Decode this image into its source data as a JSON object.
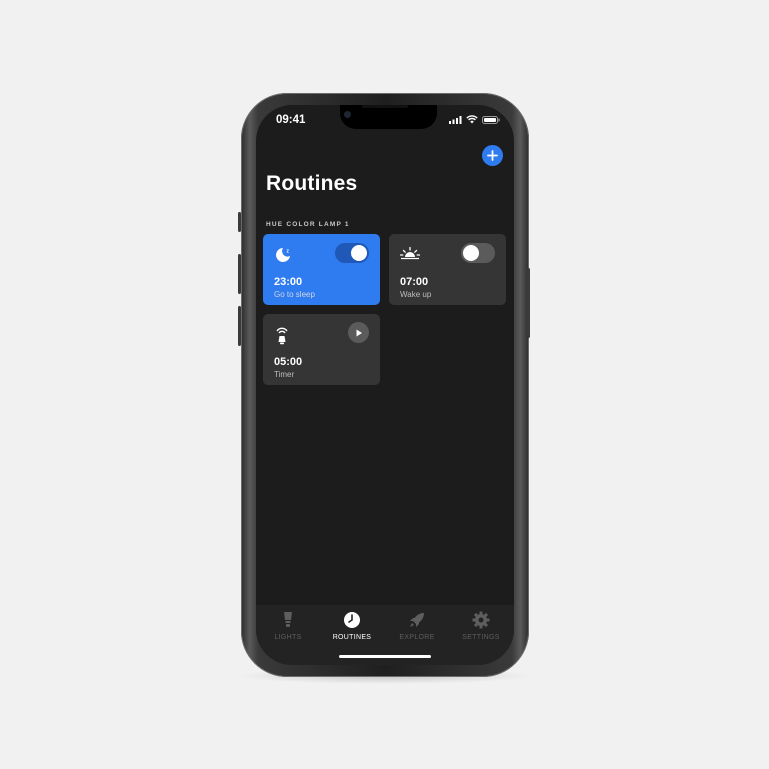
{
  "status_bar": {
    "time": "09:41"
  },
  "header": {
    "title": "Routines",
    "add_icon": "plus-icon"
  },
  "section": {
    "label": "HUE COLOR LAMP 1"
  },
  "routines": [
    {
      "time": "23:00",
      "name": "Go to sleep",
      "icon": "moon-sleep-icon",
      "control": "toggle",
      "enabled": true
    },
    {
      "time": "07:00",
      "name": "Wake up",
      "icon": "sunrise-icon",
      "control": "toggle",
      "enabled": false
    },
    {
      "time": "05:00",
      "name": "Timer",
      "icon": "timer-icon",
      "control": "play"
    }
  ],
  "tabs": [
    {
      "label": "LIGHTS",
      "icon": "bulb-icon",
      "active": false
    },
    {
      "label": "ROUTINES",
      "icon": "clock-icon",
      "active": true
    },
    {
      "label": "EXPLORE",
      "icon": "rocket-icon",
      "active": false
    },
    {
      "label": "SETTINGS",
      "icon": "gear-icon",
      "active": false
    }
  ],
  "colors": {
    "accent": "#2f7bf0",
    "card": "#353535",
    "background": "#1c1c1c"
  }
}
